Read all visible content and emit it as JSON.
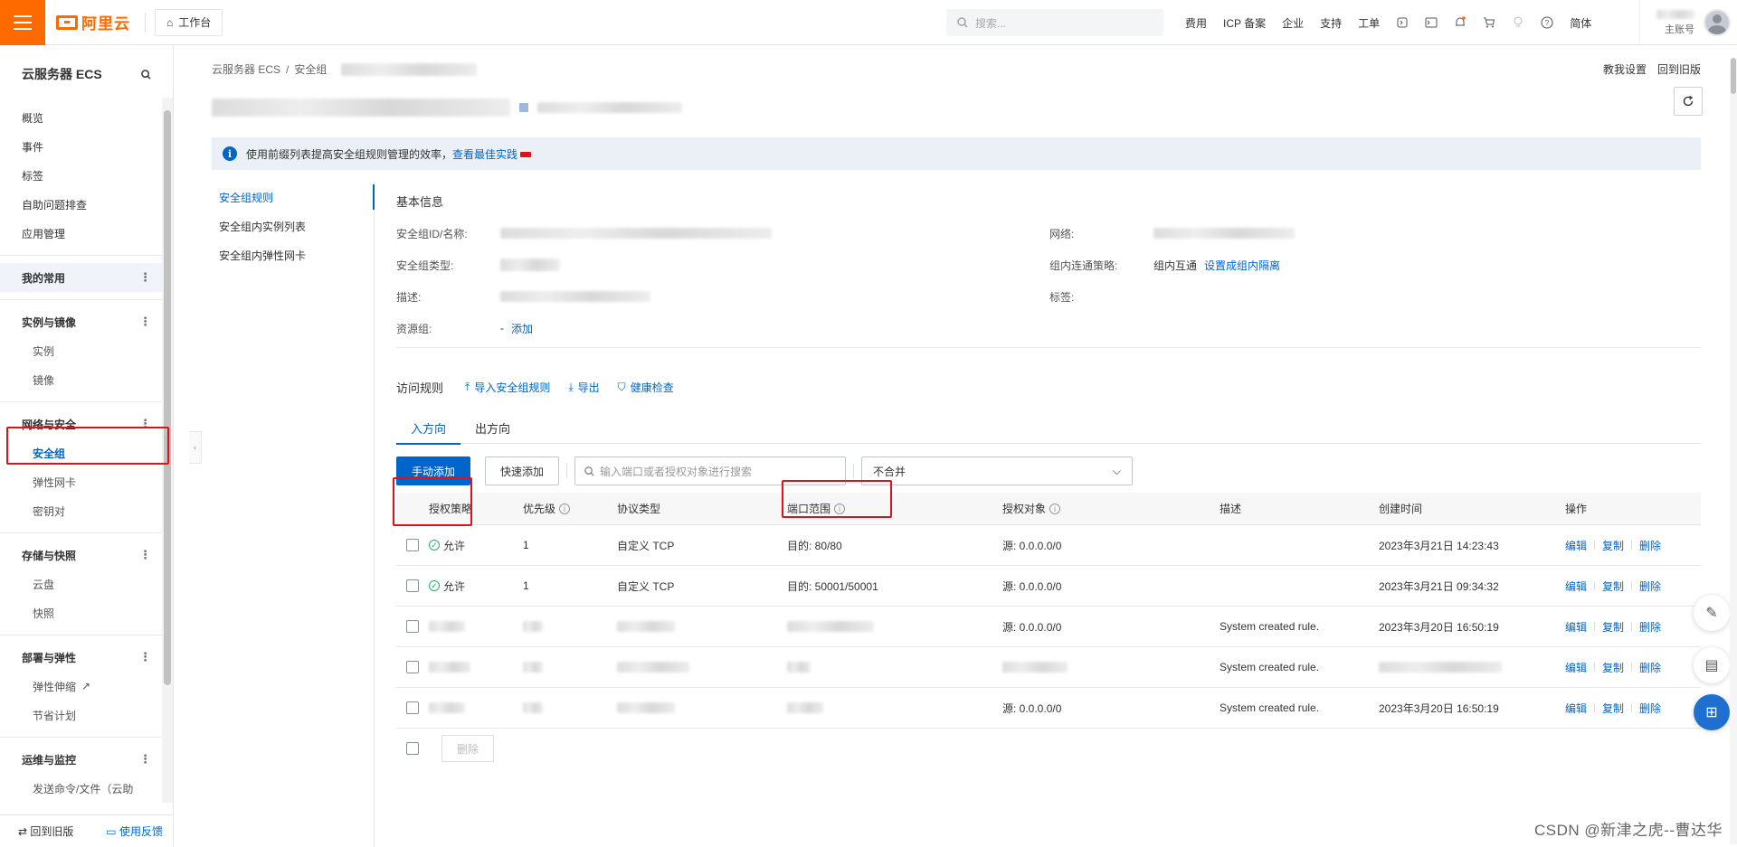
{
  "topbar": {
    "brand": "阿里云",
    "workbench": "工作台",
    "search_placeholder": "搜索...",
    "links": [
      "费用",
      "ICP 备案",
      "企业",
      "支持",
      "工单"
    ],
    "lang": "简体",
    "account_type": "主账号"
  },
  "sidebar": {
    "title": "云服务器 ECS",
    "top_items": [
      "概览",
      "事件",
      "标签",
      "自助问题排查",
      "应用管理"
    ],
    "mine": "我的常用",
    "groups": [
      {
        "title": "实例与镜像",
        "items": [
          "实例",
          "镜像"
        ]
      },
      {
        "title": "网络与安全",
        "items": [
          "安全组",
          "弹性网卡",
          "密钥对"
        ]
      },
      {
        "title": "存储与快照",
        "items": [
          "云盘",
          "快照"
        ]
      },
      {
        "title": "部署与弹性",
        "items": [
          "弹性伸缩",
          "节省计划"
        ]
      },
      {
        "title": "运维与监控",
        "items": [
          "发送命令/文件（云助"
        ]
      }
    ],
    "footer_left": "回到旧版",
    "footer_right": "使用反馈"
  },
  "main": {
    "breadcrumb": [
      "云服务器 ECS",
      "安全组"
    ],
    "top_right": [
      "教我设置",
      "回到旧版"
    ],
    "notice": "使用前缀列表提高安全组规则管理的效率，",
    "notice_link": "查看最佳实践",
    "subnav": [
      "安全组规则",
      "安全组内实例列表",
      "安全组内弹性网卡"
    ],
    "basic_title": "基本信息",
    "info": {
      "id_label": "安全组ID/名称:",
      "type_label": "安全组类型:",
      "desc_label": "描述:",
      "rg_label": "资源组:",
      "rg_value": "-",
      "rg_add": "添加",
      "net_label": "网络:",
      "policy_label": "组内连通策略:",
      "policy_value": "组内互通",
      "policy_link": "设置成组内隔离",
      "tag_label": "标签:"
    },
    "rules": {
      "title": "访问规则",
      "import": "导入安全组规则",
      "export": "导出",
      "health": "健康检查"
    },
    "tabs": [
      "入方向",
      "出方向"
    ],
    "toolbar": {
      "manual_add": "手动添加",
      "quick_add": "快速添加",
      "search_placeholder": "输入端口或者授权对象进行搜索",
      "merge_select": "不合并"
    },
    "table": {
      "headers": [
        "授权策略",
        "优先级",
        "协议类型",
        "端口范围",
        "授权对象",
        "描述",
        "创建时间",
        "操作"
      ],
      "ops": [
        "编辑",
        "复制",
        "删除"
      ],
      "rows": [
        {
          "policy": "允许",
          "priority": "1",
          "protocol": "自定义 TCP",
          "port": "目的: 80/80",
          "object": "源: 0.0.0.0/0",
          "desc": "",
          "time": "2023年3月21日 14:23:43"
        },
        {
          "policy": "允许",
          "priority": "1",
          "protocol": "自定义 TCP",
          "port": "目的: 50001/50001",
          "object": "源: 0.0.0.0/0",
          "desc": "",
          "time": "2023年3月21日 09:34:32"
        },
        {
          "policy": "",
          "priority": "",
          "protocol": "",
          "port": "",
          "object": "源: 0.0.0.0/0",
          "desc": "System created rule.",
          "time": "2023年3月20日 16:50:19"
        },
        {
          "policy": "",
          "priority": "",
          "protocol": "",
          "port": "",
          "object": "",
          "desc": "System created rule.",
          "time": ""
        },
        {
          "policy": "",
          "priority": "",
          "protocol": "",
          "port": "",
          "object": "源: 0.0.0.0/0",
          "desc": "System created rule.",
          "time": "2023年3月20日 16:50:19"
        }
      ],
      "footer_delete": "删除"
    }
  },
  "watermark": "CSDN @新津之虎--曹达华"
}
